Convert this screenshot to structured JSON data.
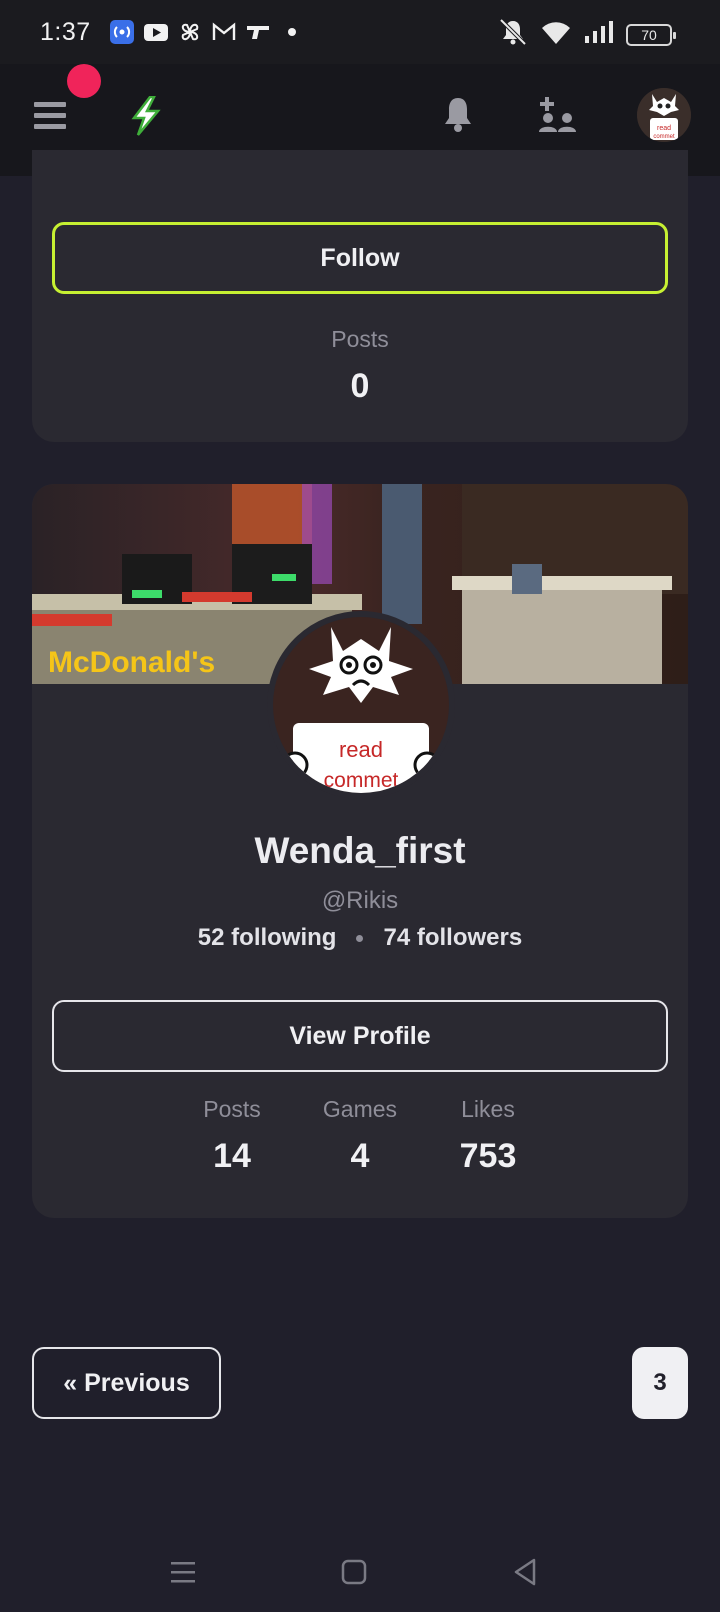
{
  "status_bar": {
    "time": "1:37",
    "battery": "70",
    "icons": [
      "radio-icon",
      "youtube-icon",
      "pinwheel-icon",
      "gmail-icon",
      "gun-icon",
      "dot-icon"
    ],
    "right_icons": [
      "mute-icon",
      "wifi-icon",
      "signal-icon",
      "battery-icon"
    ]
  },
  "header": {
    "logo": "lightning-logo-icon",
    "notification_dot_color": "#f0245a"
  },
  "top_card": {
    "follow_label": "Follow",
    "follow_border_color": "#c6f032",
    "posts_label": "Posts",
    "posts_value": "0"
  },
  "user_card": {
    "banner_text": "McDonald's",
    "avatar_text_line1": "read",
    "avatar_text_line2": "commet",
    "username": "Wenda_first",
    "handle": "@Rikis",
    "following": "52 following",
    "followers": "74 followers",
    "view_profile_label": "View Profile",
    "stats": [
      {
        "label": "Posts",
        "value": "14"
      },
      {
        "label": "Games",
        "value": "4"
      },
      {
        "label": "Likes",
        "value": "753"
      }
    ]
  },
  "pagination": {
    "previous_label": "« Previous",
    "current_page": "3"
  },
  "nav_bar": {
    "buttons": [
      "menu-icon",
      "home-icon",
      "back-icon"
    ]
  }
}
